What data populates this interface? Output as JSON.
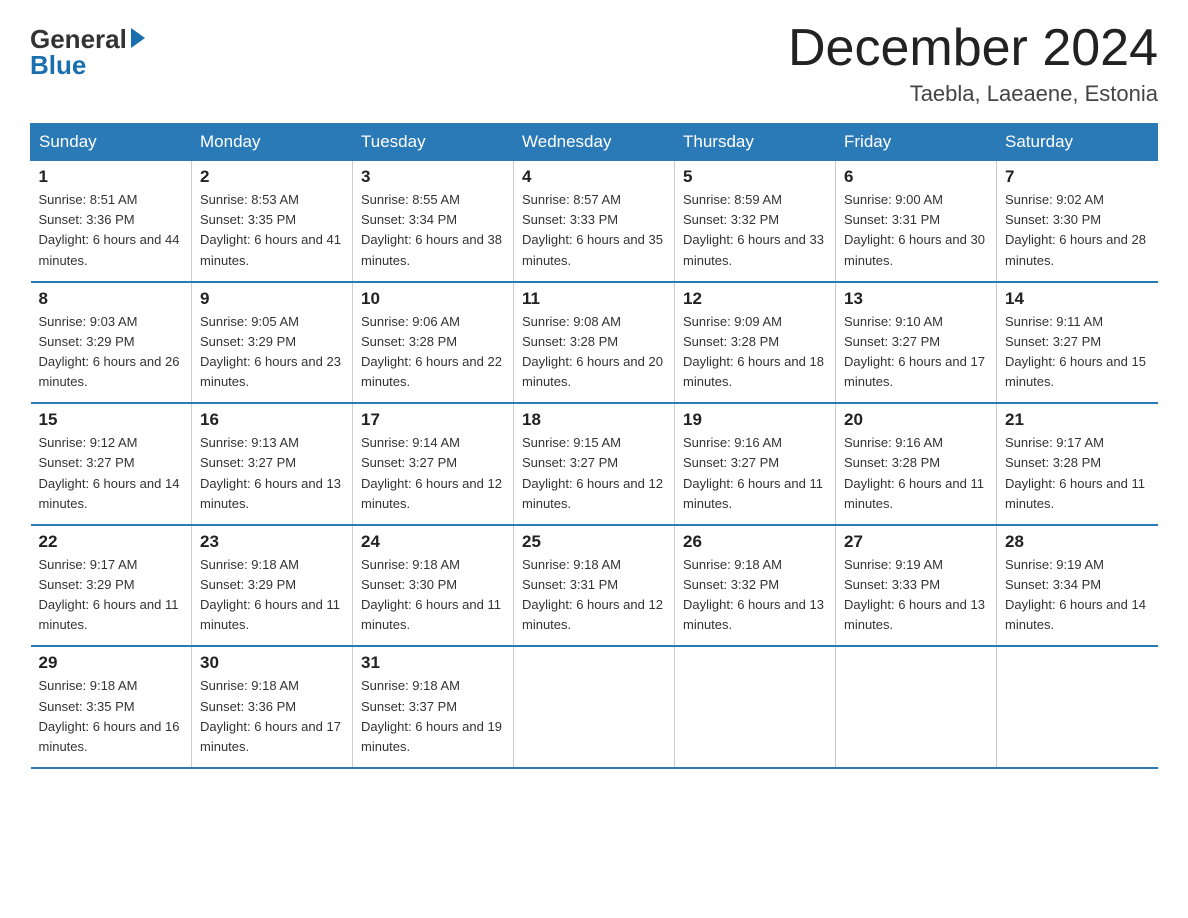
{
  "logo": {
    "general": "General",
    "blue": "Blue"
  },
  "title": "December 2024",
  "location": "Taebla, Laeaene, Estonia",
  "weekdays": [
    "Sunday",
    "Monday",
    "Tuesday",
    "Wednesday",
    "Thursday",
    "Friday",
    "Saturday"
  ],
  "weeks": [
    [
      {
        "day": "1",
        "sunrise": "8:51 AM",
        "sunset": "3:36 PM",
        "daylight": "6 hours and 44 minutes."
      },
      {
        "day": "2",
        "sunrise": "8:53 AM",
        "sunset": "3:35 PM",
        "daylight": "6 hours and 41 minutes."
      },
      {
        "day": "3",
        "sunrise": "8:55 AM",
        "sunset": "3:34 PM",
        "daylight": "6 hours and 38 minutes."
      },
      {
        "day": "4",
        "sunrise": "8:57 AM",
        "sunset": "3:33 PM",
        "daylight": "6 hours and 35 minutes."
      },
      {
        "day": "5",
        "sunrise": "8:59 AM",
        "sunset": "3:32 PM",
        "daylight": "6 hours and 33 minutes."
      },
      {
        "day": "6",
        "sunrise": "9:00 AM",
        "sunset": "3:31 PM",
        "daylight": "6 hours and 30 minutes."
      },
      {
        "day": "7",
        "sunrise": "9:02 AM",
        "sunset": "3:30 PM",
        "daylight": "6 hours and 28 minutes."
      }
    ],
    [
      {
        "day": "8",
        "sunrise": "9:03 AM",
        "sunset": "3:29 PM",
        "daylight": "6 hours and 26 minutes."
      },
      {
        "day": "9",
        "sunrise": "9:05 AM",
        "sunset": "3:29 PM",
        "daylight": "6 hours and 23 minutes."
      },
      {
        "day": "10",
        "sunrise": "9:06 AM",
        "sunset": "3:28 PM",
        "daylight": "6 hours and 22 minutes."
      },
      {
        "day": "11",
        "sunrise": "9:08 AM",
        "sunset": "3:28 PM",
        "daylight": "6 hours and 20 minutes."
      },
      {
        "day": "12",
        "sunrise": "9:09 AM",
        "sunset": "3:28 PM",
        "daylight": "6 hours and 18 minutes."
      },
      {
        "day": "13",
        "sunrise": "9:10 AM",
        "sunset": "3:27 PM",
        "daylight": "6 hours and 17 minutes."
      },
      {
        "day": "14",
        "sunrise": "9:11 AM",
        "sunset": "3:27 PM",
        "daylight": "6 hours and 15 minutes."
      }
    ],
    [
      {
        "day": "15",
        "sunrise": "9:12 AM",
        "sunset": "3:27 PM",
        "daylight": "6 hours and 14 minutes."
      },
      {
        "day": "16",
        "sunrise": "9:13 AM",
        "sunset": "3:27 PM",
        "daylight": "6 hours and 13 minutes."
      },
      {
        "day": "17",
        "sunrise": "9:14 AM",
        "sunset": "3:27 PM",
        "daylight": "6 hours and 12 minutes."
      },
      {
        "day": "18",
        "sunrise": "9:15 AM",
        "sunset": "3:27 PM",
        "daylight": "6 hours and 12 minutes."
      },
      {
        "day": "19",
        "sunrise": "9:16 AM",
        "sunset": "3:27 PM",
        "daylight": "6 hours and 11 minutes."
      },
      {
        "day": "20",
        "sunrise": "9:16 AM",
        "sunset": "3:28 PM",
        "daylight": "6 hours and 11 minutes."
      },
      {
        "day": "21",
        "sunrise": "9:17 AM",
        "sunset": "3:28 PM",
        "daylight": "6 hours and 11 minutes."
      }
    ],
    [
      {
        "day": "22",
        "sunrise": "9:17 AM",
        "sunset": "3:29 PM",
        "daylight": "6 hours and 11 minutes."
      },
      {
        "day": "23",
        "sunrise": "9:18 AM",
        "sunset": "3:29 PM",
        "daylight": "6 hours and 11 minutes."
      },
      {
        "day": "24",
        "sunrise": "9:18 AM",
        "sunset": "3:30 PM",
        "daylight": "6 hours and 11 minutes."
      },
      {
        "day": "25",
        "sunrise": "9:18 AM",
        "sunset": "3:31 PM",
        "daylight": "6 hours and 12 minutes."
      },
      {
        "day": "26",
        "sunrise": "9:18 AM",
        "sunset": "3:32 PM",
        "daylight": "6 hours and 13 minutes."
      },
      {
        "day": "27",
        "sunrise": "9:19 AM",
        "sunset": "3:33 PM",
        "daylight": "6 hours and 13 minutes."
      },
      {
        "day": "28",
        "sunrise": "9:19 AM",
        "sunset": "3:34 PM",
        "daylight": "6 hours and 14 minutes."
      }
    ],
    [
      {
        "day": "29",
        "sunrise": "9:18 AM",
        "sunset": "3:35 PM",
        "daylight": "6 hours and 16 minutes."
      },
      {
        "day": "30",
        "sunrise": "9:18 AM",
        "sunset": "3:36 PM",
        "daylight": "6 hours and 17 minutes."
      },
      {
        "day": "31",
        "sunrise": "9:18 AM",
        "sunset": "3:37 PM",
        "daylight": "6 hours and 19 minutes."
      },
      null,
      null,
      null,
      null
    ]
  ]
}
